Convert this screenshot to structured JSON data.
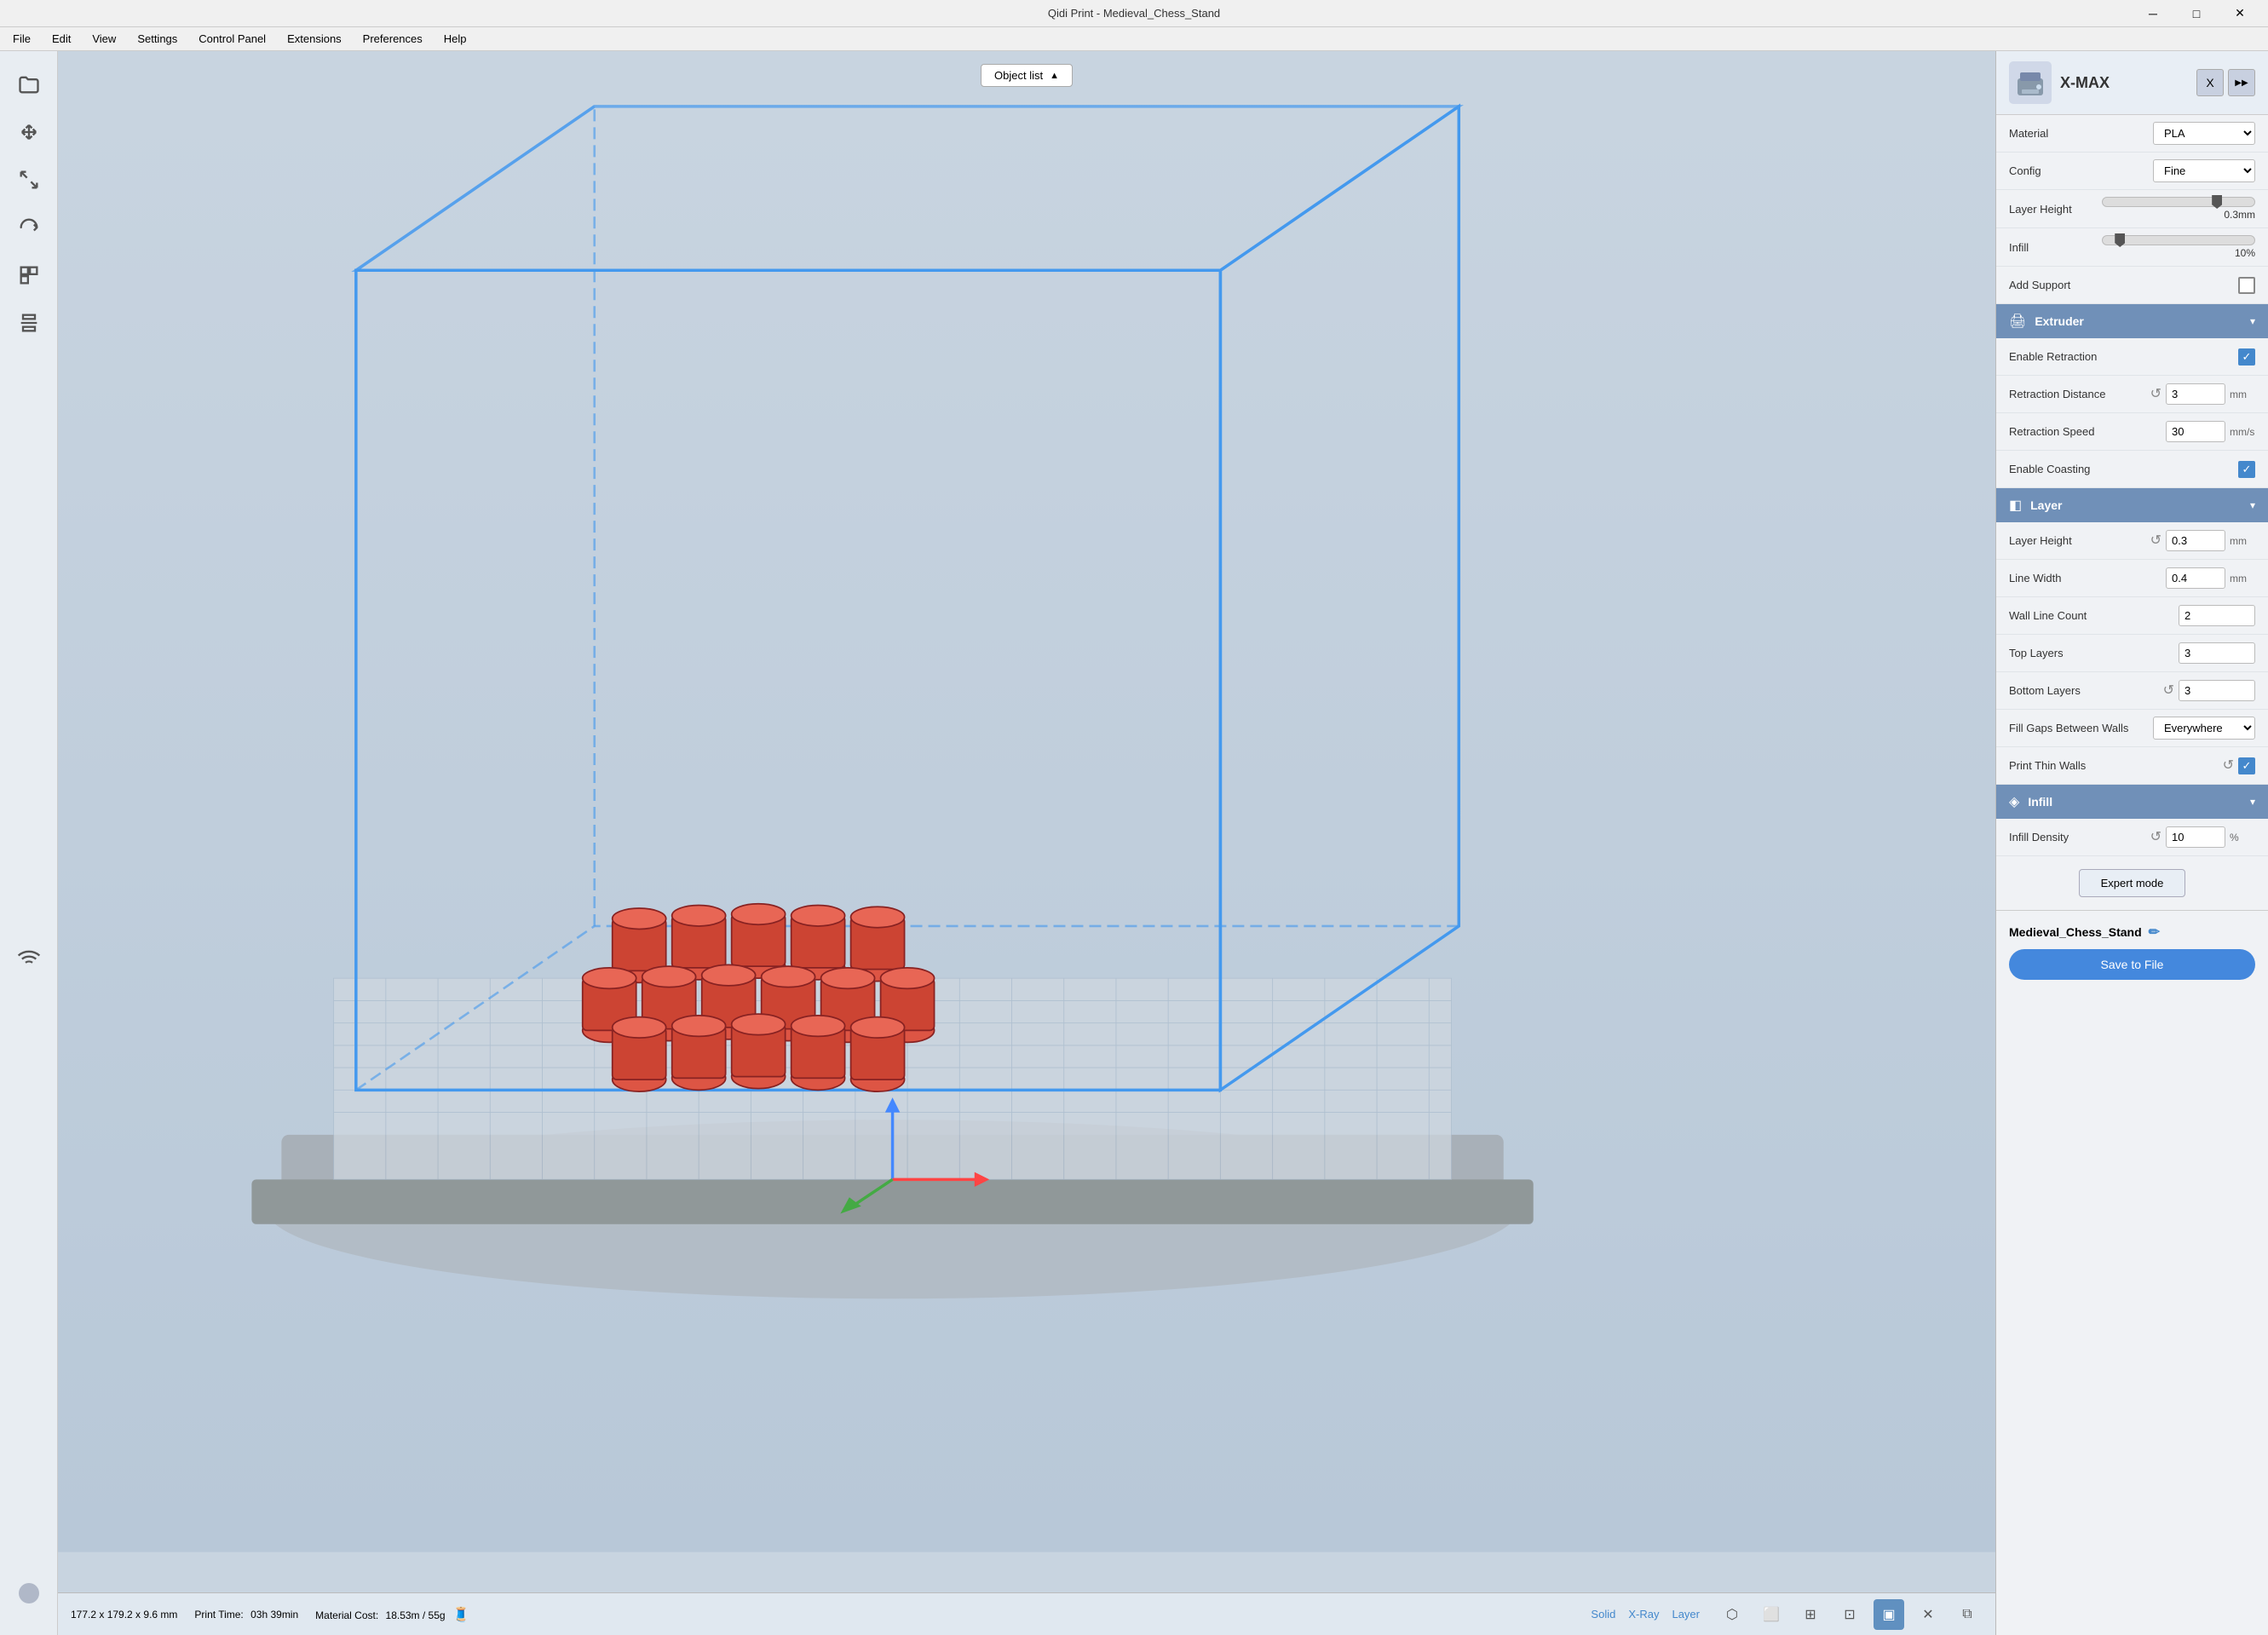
{
  "window": {
    "title": "Qidi Print - Medieval_Chess_Stand"
  },
  "titlebar": {
    "minimize_label": "─",
    "maximize_label": "□",
    "close_label": "✕"
  },
  "menubar": {
    "items": [
      "File",
      "Edit",
      "View",
      "Settings",
      "Control Panel",
      "Extensions",
      "Preferences",
      "Help"
    ]
  },
  "viewport": {
    "object_list_label": "Object list",
    "object_list_chevron": "▲"
  },
  "toolbar": {
    "tools": [
      {
        "name": "folder-icon",
        "symbol": "📁"
      },
      {
        "name": "move-icon",
        "symbol": "✛"
      },
      {
        "name": "scale-icon",
        "symbol": "⤡"
      },
      {
        "name": "rotate-icon",
        "symbol": "↺"
      },
      {
        "name": "slice-icon",
        "symbol": "◫"
      },
      {
        "name": "arrange-icon",
        "symbol": "▦"
      },
      {
        "name": "wifi-icon",
        "symbol": "📶"
      }
    ]
  },
  "right_panel": {
    "printer_name": "X-MAX",
    "printer_icon_x_label": "X",
    "printer_icon_arrow_label": "▶▶",
    "material_label": "Material",
    "material_value": "PLA",
    "config_label": "Config",
    "config_value": "Fine",
    "layer_height_label": "Layer Height",
    "layer_height_value": "0.3mm",
    "layer_height_thumb_pos": "75",
    "infill_label": "Infill",
    "infill_value": "10%",
    "infill_thumb_pos": "15",
    "add_support_label": "Add Support",
    "extruder_section": {
      "title": "Extruder",
      "icon": "🖨",
      "settings": [
        {
          "label": "Enable Retraction",
          "type": "checkbox",
          "checked": true
        },
        {
          "label": "Retraction Distance",
          "type": "number_reset",
          "value": "3",
          "unit": "mm"
        },
        {
          "label": "Retraction Speed",
          "type": "number",
          "value": "30",
          "unit": "mm/s"
        },
        {
          "label": "Enable Coasting",
          "type": "checkbox",
          "checked": true
        }
      ]
    },
    "layer_section": {
      "title": "Layer",
      "icon": "◧",
      "settings": [
        {
          "label": "Layer Height",
          "type": "number_reset",
          "value": "0.3",
          "unit": "mm"
        },
        {
          "label": "Line Width",
          "type": "number",
          "value": "0.4",
          "unit": "mm"
        },
        {
          "label": "Wall Line Count",
          "type": "number",
          "value": "2",
          "unit": ""
        },
        {
          "label": "Top Layers",
          "type": "number",
          "value": "3",
          "unit": ""
        },
        {
          "label": "Bottom Layers",
          "type": "number_reset",
          "value": "3",
          "unit": ""
        },
        {
          "label": "Fill Gaps Between Walls",
          "type": "dropdown",
          "value": "Everywhere"
        },
        {
          "label": "Print Thin Walls",
          "type": "checkbox_reset",
          "checked": true
        }
      ]
    },
    "infill_section": {
      "title": "Infill",
      "icon": "◈",
      "settings": [
        {
          "label": "Infill Density",
          "type": "number_reset",
          "value": "10",
          "unit": "%"
        }
      ]
    },
    "expert_mode_label": "Expert mode",
    "file_name": "Medieval_Chess_Stand",
    "save_label": "Save to File"
  },
  "bottombar": {
    "dimensions": "177.2 x 179.2 x 9.6 mm",
    "print_time_label": "Print Time:",
    "print_time": "03h 39min",
    "material_cost_label": "Material Cost:",
    "material_cost": "18.53m / 55g",
    "view_modes": [
      "Solid",
      "X-Ray",
      "Layer"
    ]
  }
}
